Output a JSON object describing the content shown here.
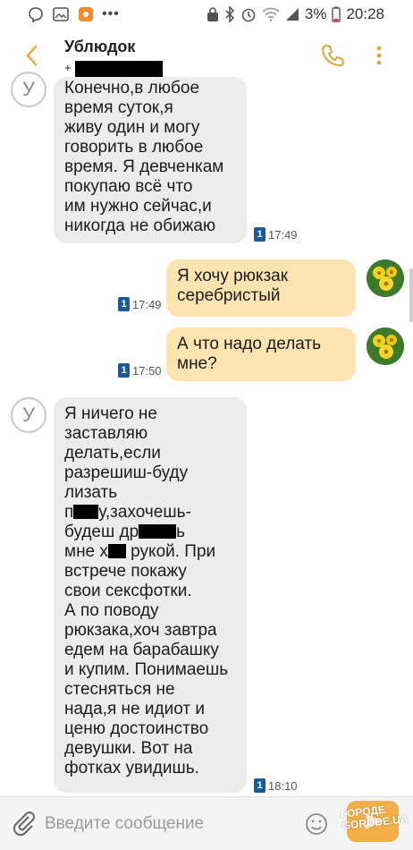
{
  "status_bar": {
    "battery": "3%",
    "time": "20:28",
    "icons": [
      "viber-icon",
      "gallery-icon",
      "app-icon",
      "more-dots-icon",
      "lock-icon",
      "bluetooth-icon",
      "alarm-icon",
      "wifi-icon",
      "signal-icon",
      "battery-icon"
    ]
  },
  "header": {
    "contact_name": "Ублюдок",
    "contact_number_prefix": "+",
    "back_icon": "back-arrow-icon",
    "call_icon": "phone-icon",
    "menu_icon": "more-vertical-icon"
  },
  "messages": [
    {
      "direction": "incoming",
      "avatar_letter": "У",
      "lines": [
        "Конечно,в любое",
        "время суток,я",
        "живу один и могу",
        "говорить в любое",
        "время. Я девченкам",
        "покупаю всё что",
        "им нужно сейчас,и",
        "никогда не обижаю"
      ],
      "sim": "1",
      "time": "17:49"
    },
    {
      "direction": "outgoing",
      "lines": [
        "Я хочу рюкзак",
        "серебристый"
      ],
      "sim": "1",
      "time": "17:49"
    },
    {
      "direction": "outgoing",
      "lines": [
        "А что надо делать",
        "мне?"
      ],
      "sim": "1",
      "time": "17:50"
    },
    {
      "direction": "incoming",
      "avatar_letter": "У",
      "lines_a": [
        "Я ничего не",
        "заставляю",
        "делать,если",
        "разрешиш-буду",
        "лизать"
      ],
      "line_p_start": "п",
      "line_p_end": "у,захочешь-",
      "line_d_start": "будеш др",
      "line_d_end": "ь",
      "line_m_start": "мне х",
      "line_m_end": " рукой. При",
      "lines_b": [
        "встрече покажу",
        "свои сексфотки.",
        "А по поводу",
        "рюкзака,хоч завтра",
        "едем на барабашку",
        "и купим. Понимаешь",
        "стесняться не",
        "нада,я не идиот и",
        "ценю достоинство",
        "девушки. Вот на",
        "фотках увидишь."
      ],
      "sim": "1",
      "time": "18:10"
    }
  ],
  "input": {
    "placeholder": "Введите сообщение",
    "attach_icon": "paperclip-icon",
    "emoji_icon": "emoji-icon",
    "send_icon": "send-icon"
  },
  "watermark": {
    "line1": "ГОРОДЕ",
    "line2": "GORODE.UA"
  },
  "colors": {
    "incoming_bubble": "#ececec",
    "outgoing_bubble": "#fbe4b0",
    "accent": "#e6a33a",
    "sim_badge": "#1d5a9c"
  }
}
